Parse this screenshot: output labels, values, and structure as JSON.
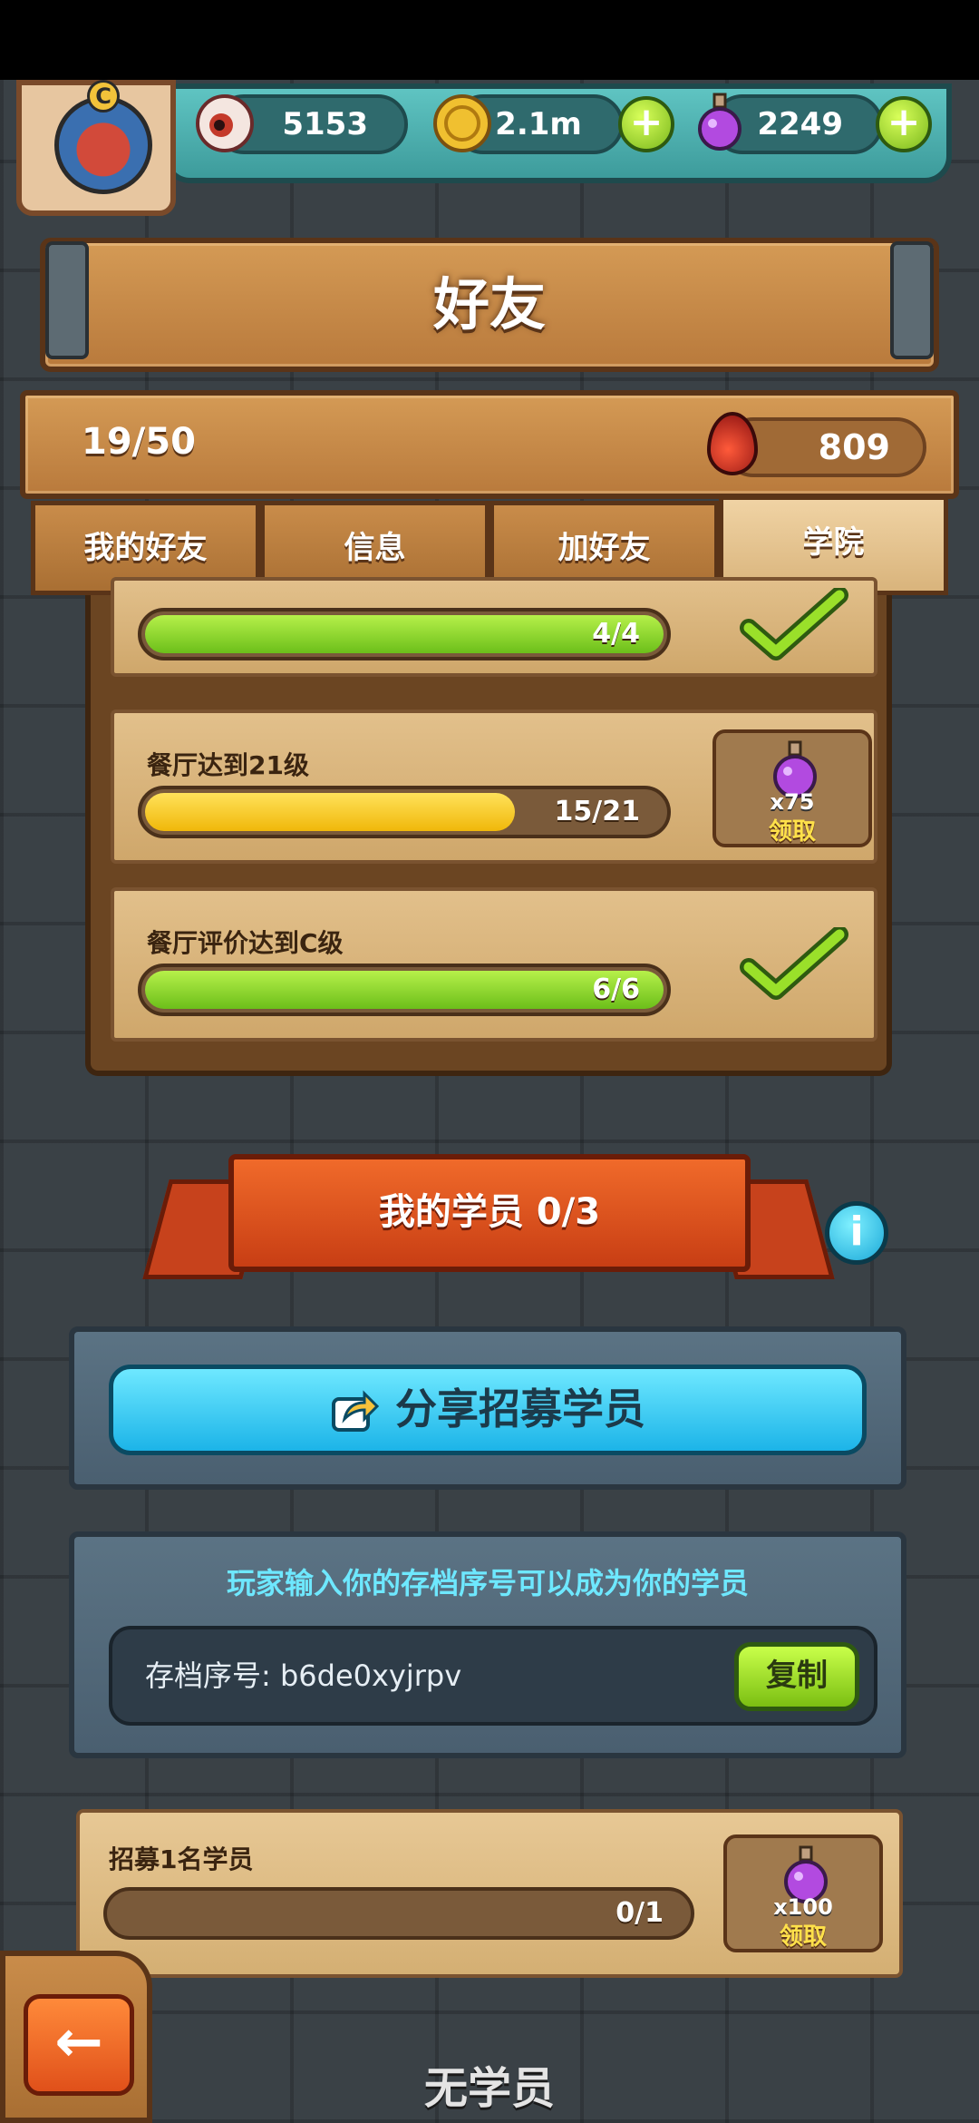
{
  "header": {
    "avatar_letter": "C",
    "eyes_count": "5153",
    "coins_count": "2.1m",
    "potions_count": "2249"
  },
  "title": "好友",
  "stats": {
    "friends_count": "19/50",
    "blood_count": "809"
  },
  "tabs": [
    {
      "label": "我的好友",
      "active": false
    },
    {
      "label": "信息",
      "active": false
    },
    {
      "label": "加好友",
      "active": false
    },
    {
      "label": "学院",
      "active": true
    }
  ],
  "tasks": [
    {
      "label": "",
      "progress_text": "4/4",
      "progress": 1.0,
      "color": "green",
      "completed": true
    },
    {
      "label": "餐厅达到21级",
      "progress_text": "15/21",
      "progress": 0.714,
      "color": "yellow",
      "completed": false,
      "reward_count": "x75",
      "reward_claim": "领取"
    },
    {
      "label": "餐厅评价达到C级",
      "progress_text": "6/6",
      "progress": 1.0,
      "color": "green",
      "completed": true
    }
  ],
  "students": {
    "banner": "我的学员 0/3",
    "share_button": "分享招募学员",
    "code_hint": "玩家输入你的存档序号可以成为你的学员",
    "code_label": "存档序号: b6de0xyjrpv",
    "copy_button": "复制",
    "recruit_task": {
      "label": "招募1名学员",
      "progress_text": "0/1",
      "progress": 0.0,
      "reward_count": "x100",
      "reward_claim": "领取"
    },
    "empty_text": "无学员"
  },
  "colors": {
    "wood": "#c98c4a",
    "slate": "#4a5f70",
    "accent_cyan": "#1cb4e8",
    "accent_green": "#7bbf12",
    "banner_red": "#c83e14"
  }
}
